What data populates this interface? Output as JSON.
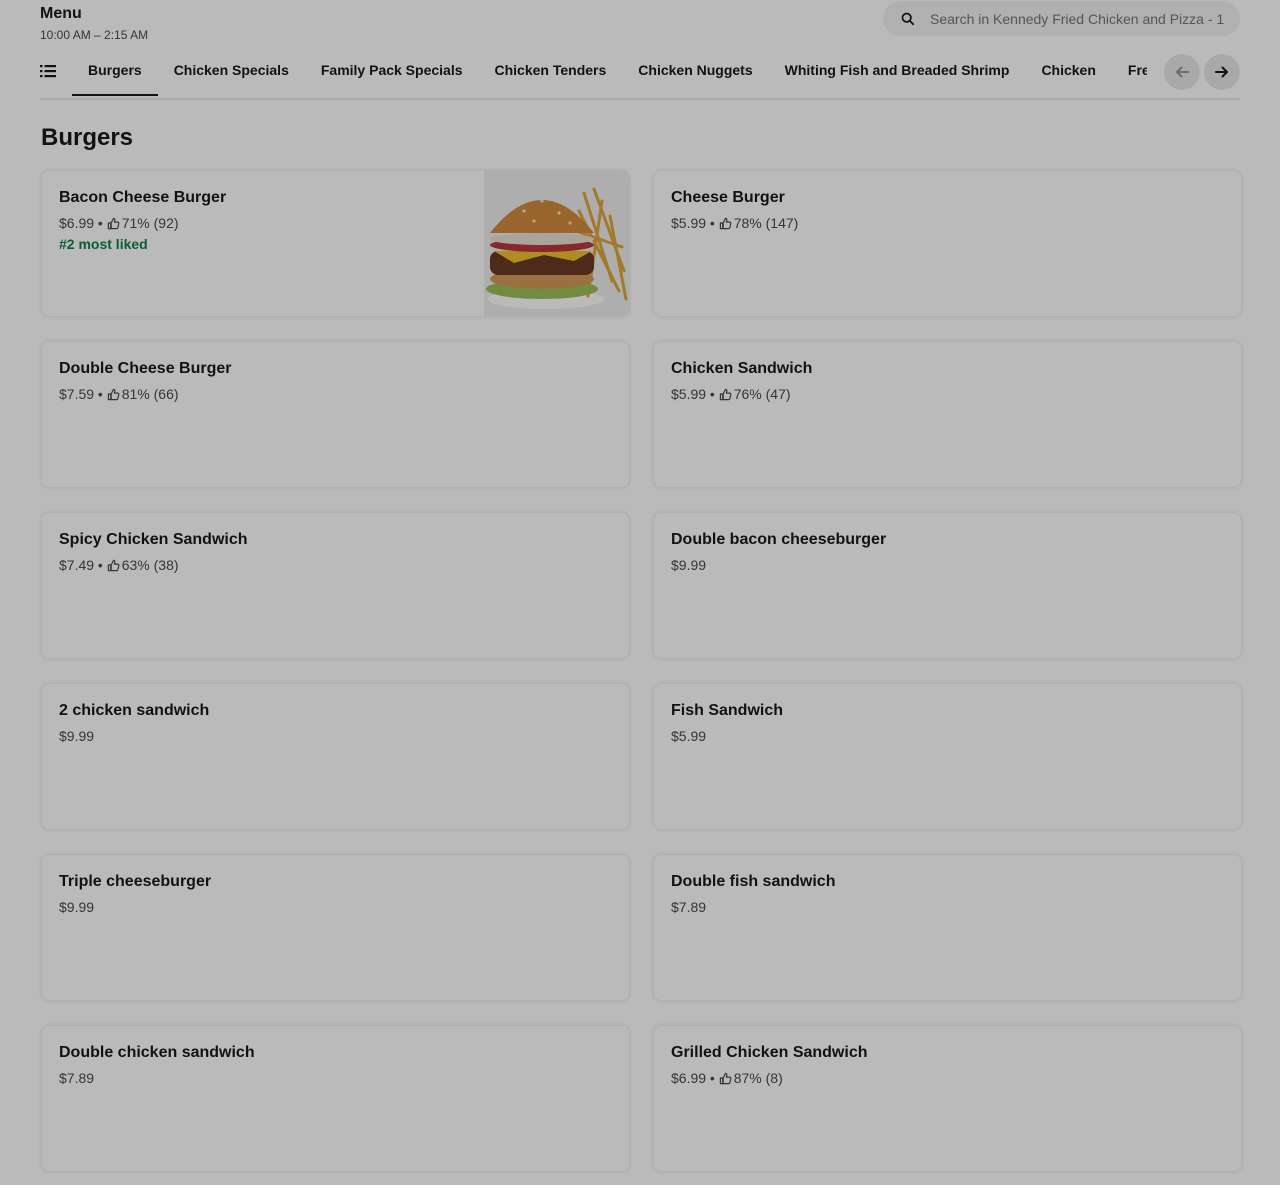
{
  "header": {
    "title": "Menu",
    "hours": "10:00 AM – 2:15 AM",
    "search_placeholder": "Search in Kennedy Fried Chicken and Pizza - 1"
  },
  "categories": {
    "tabs": [
      "Burgers",
      "Chicken Specials",
      "Family Pack Specials",
      "Chicken Tenders",
      "Chicken Nuggets",
      "Whiting Fish and Breaded Shrimp",
      "Chicken",
      "Fresh Salads"
    ],
    "active": "Burgers"
  },
  "section": {
    "title": "Burgers",
    "items": [
      {
        "name": "Bacon Cheese Burger",
        "price": "$6.99",
        "rating": "71% (92)",
        "badge": "#2 most liked",
        "has_image": true
      },
      {
        "name": "Cheese Burger",
        "price": "$5.99",
        "rating": "78% (147)"
      },
      {
        "name": "Double Cheese Burger",
        "price": "$7.59",
        "rating": "81% (66)"
      },
      {
        "name": "Chicken Sandwich",
        "price": "$5.99",
        "rating": "76% (47)"
      },
      {
        "name": "Spicy Chicken Sandwich",
        "price": "$7.49",
        "rating": "63% (38)"
      },
      {
        "name": "Double bacon cheeseburger",
        "price": "$9.99"
      },
      {
        "name": "2 chicken sandwich",
        "price": "$9.99"
      },
      {
        "name": "Fish Sandwich",
        "price": "$5.99"
      },
      {
        "name": "Triple cheeseburger",
        "price": "$9.99"
      },
      {
        "name": "Double fish sandwich",
        "price": "$7.89"
      },
      {
        "name": "Double chicken sandwich",
        "price": "$7.89"
      },
      {
        "name": "Grilled Chicken Sandwich",
        "price": "$6.99",
        "rating": "87% (8)"
      }
    ]
  },
  "colors": {
    "badge": "#0e8345",
    "overlay": "rgba(0,0,0,0.27)"
  },
  "icons": [
    "search-icon",
    "list-icon",
    "arrow-left-icon",
    "arrow-right-icon",
    "thumbs-up-icon"
  ]
}
